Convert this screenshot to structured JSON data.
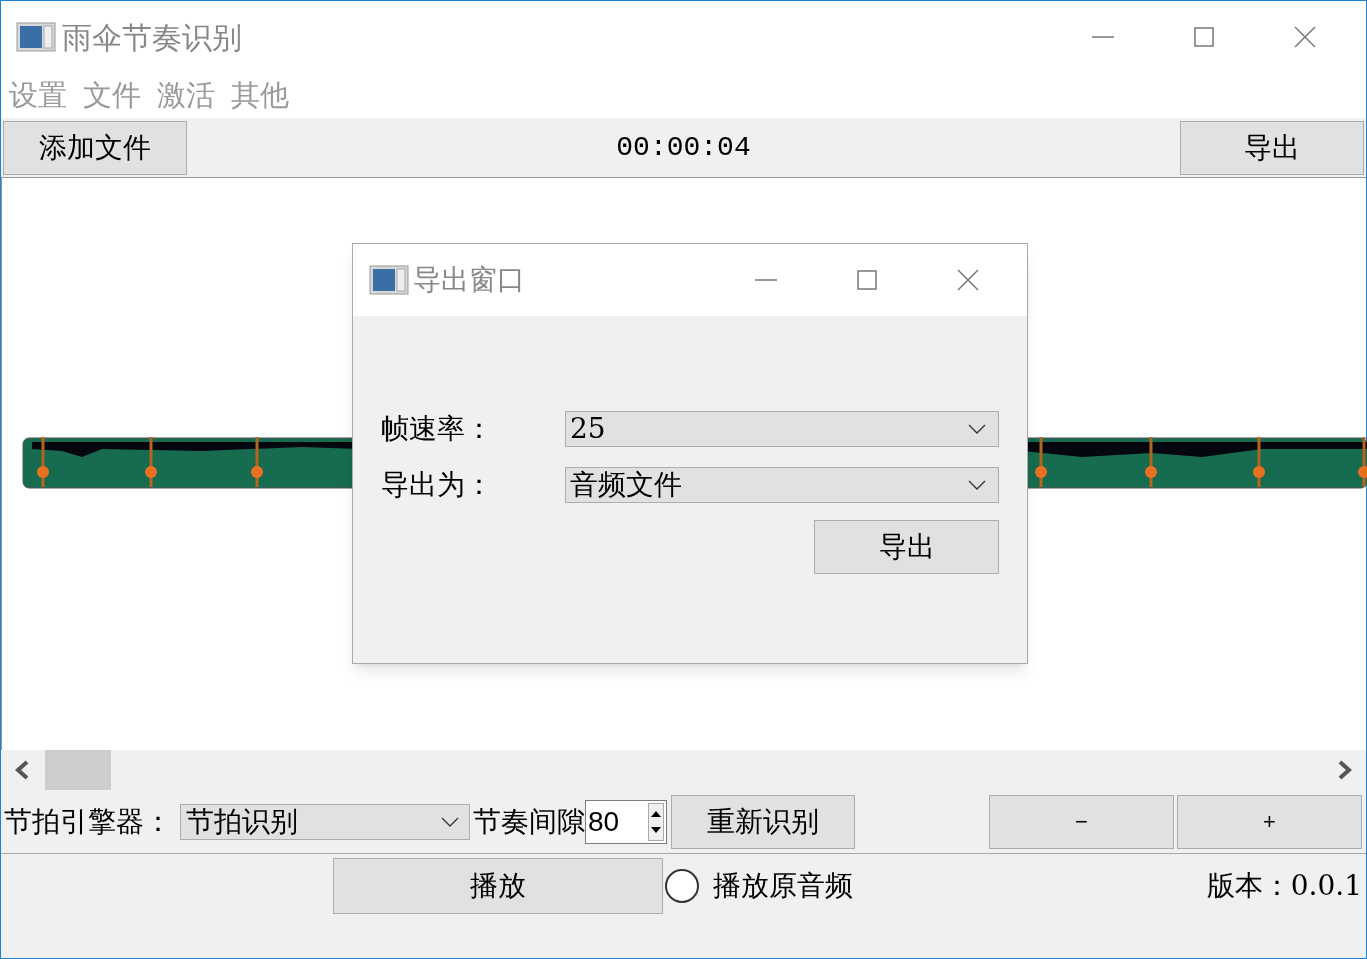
{
  "window": {
    "title": "雨伞节奏识别"
  },
  "menu": [
    "设置",
    "文件",
    "激活",
    "其他"
  ],
  "toolbar": {
    "add_button": "添加文件",
    "time": "00:00:04",
    "export_button": "导出"
  },
  "dialog": {
    "title": "导出窗口",
    "fields": [
      {
        "label": "帧速率：",
        "value": "25"
      },
      {
        "label": "导出为：",
        "value": "音频文件"
      }
    ],
    "button": "导出"
  },
  "controls": {
    "engine_label": "节拍引擎器：",
    "engine_value": "节拍识别",
    "gap_label": "节奏间隙",
    "gap_value": "80",
    "redetect_button": "重新识别",
    "minus_button": "−",
    "plus_button": "+"
  },
  "bottom": {
    "play_button": "播放",
    "original_audio": {
      "label": "播放原音频",
      "checked": false
    },
    "version": "版本：0.0.1"
  }
}
